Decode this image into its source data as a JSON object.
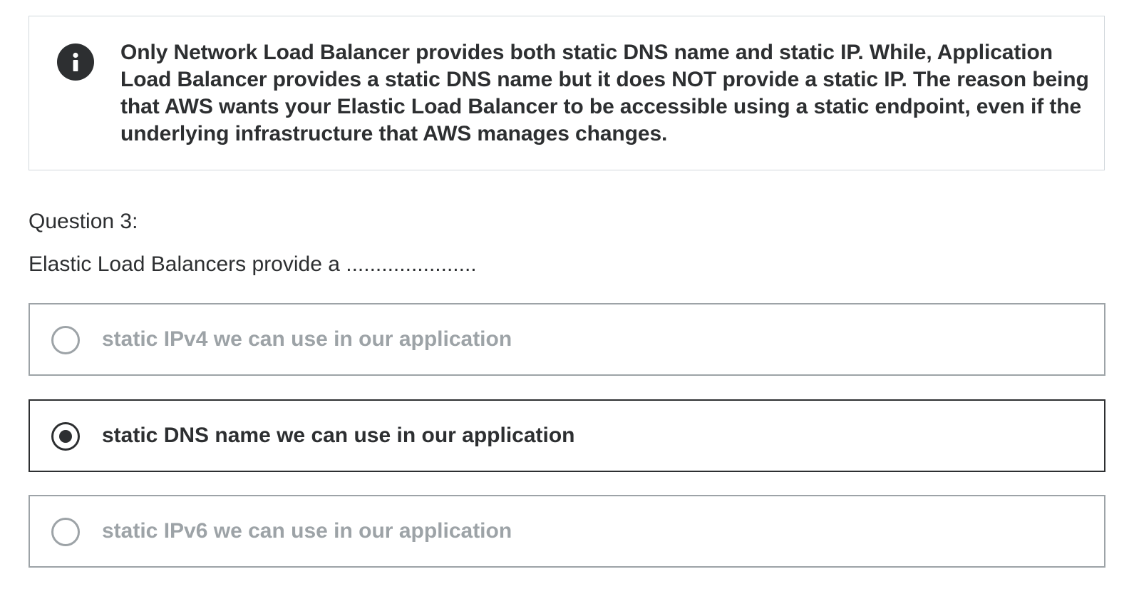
{
  "info": {
    "icon": "info-icon",
    "text": "Only Network Load Balancer provides both static DNS name and static IP. While, Application Load Balancer provides a static DNS name but it does NOT provide a static IP. The reason being that AWS wants your Elastic Load Balancer to be accessible using a static endpoint, even if the underlying infrastructure that AWS manages changes."
  },
  "question": {
    "label": "Question 3:",
    "prompt": "Elastic Load Balancers provide a ......................",
    "options": [
      {
        "label": "static IPv4 we can use in our application",
        "selected": false
      },
      {
        "label": "static DNS name we can use in our application",
        "selected": true
      },
      {
        "label": "static IPv6 we can use in our application",
        "selected": false
      }
    ]
  },
  "colors": {
    "text": "#2d2f31",
    "muted": "#9da3a7",
    "border": "#d1d7dc",
    "background": "#ffffff"
  }
}
